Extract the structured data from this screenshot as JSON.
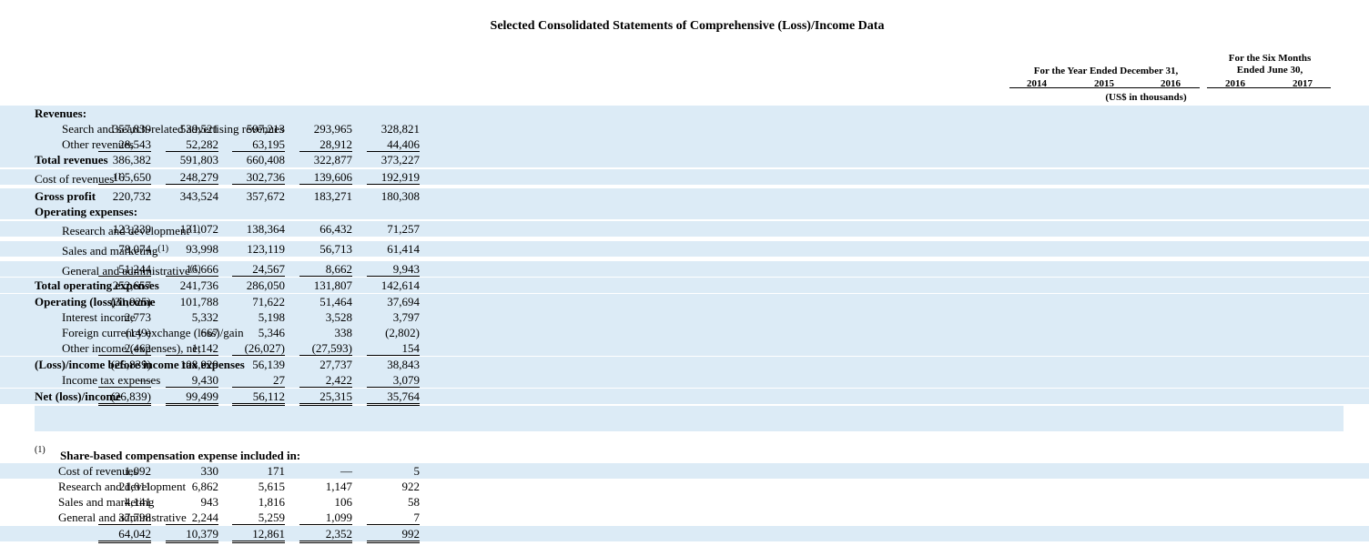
{
  "title": "Selected Consolidated Statements of Comprehensive (Loss)/Income Data",
  "header": {
    "year_group": "For the Year Ended December 31,",
    "six_group_line1": "For the Six Months",
    "six_group_line2": "Ended June 30,",
    "cols": [
      "2014",
      "2015",
      "2016",
      "2016",
      "2017"
    ],
    "units": "(US$ in thousands)"
  },
  "rows": [
    {
      "label": "Revenues:",
      "bold": true,
      "indent": 0,
      "values": []
    },
    {
      "label": "Search and search-related advertising revenues",
      "indent": 1,
      "values": [
        "357,839",
        "539,521",
        "597,213",
        "293,965",
        "328,821"
      ]
    },
    {
      "label": "Other revenues",
      "indent": 1,
      "values": [
        "28,543",
        "52,282",
        "63,195",
        "28,912",
        "44,406"
      ]
    },
    {
      "label": "Total revenues",
      "bold": true,
      "indent": 0,
      "values": [
        "386,382",
        "591,803",
        "660,408",
        "322,877",
        "373,227"
      ]
    },
    {
      "label": "Cost of revenues",
      "sup": "(1)",
      "indent": 0,
      "values": [
        "165,650",
        "248,279",
        "302,736",
        "139,606",
        "192,919"
      ]
    },
    {
      "label": "Gross profit",
      "bold": true,
      "indent": 0,
      "values": [
        "220,732",
        "343,524",
        "357,672",
        "183,271",
        "180,308"
      ]
    },
    {
      "label": "Operating expenses:",
      "bold": true,
      "indent": 0,
      "values": []
    },
    {
      "label": "Research and development",
      "sup": "(1)",
      "indent": 1,
      "values": [
        "123,339",
        "131,072",
        "138,364",
        "66,432",
        "71,257"
      ]
    },
    {
      "label": "Sales and marketing",
      "sup": "(1)",
      "indent": 1,
      "values": [
        "78,074",
        "93,998",
        "123,119",
        "56,713",
        "61,414"
      ]
    },
    {
      "label": "General and administrative",
      "sup": "(1)",
      "indent": 1,
      "values": [
        "51,244",
        "16,666",
        "24,567",
        "8,662",
        "9,943"
      ]
    },
    {
      "label": "Total operating expenses",
      "bold": true,
      "indent": 0,
      "values": [
        "252,657",
        "241,736",
        "286,050",
        "131,807",
        "142,614"
      ]
    },
    {
      "label": "Operating (loss)/income",
      "bold": true,
      "indent": 0,
      "values": [
        "(31,925)",
        "101,788",
        "71,622",
        "51,464",
        "37,694"
      ]
    },
    {
      "label": "Interest income",
      "indent": 1,
      "values": [
        "2,773",
        "5,332",
        "5,198",
        "3,528",
        "3,797"
      ]
    },
    {
      "label": "Foreign currency exchange (loss)/gain",
      "indent": 1,
      "values": [
        "(149)",
        "667",
        "5,346",
        "338",
        "(2,802)"
      ]
    },
    {
      "label": "Other income/(expenses), net",
      "indent": 1,
      "values": [
        "2,462",
        "1,142",
        "(26,027)",
        "(27,593)",
        "154"
      ]
    },
    {
      "label": "(Loss)/income before income tax expenses",
      "bold": true,
      "indent": 0,
      "values": [
        "(26,839)",
        "108,929",
        "56,139",
        "27,737",
        "38,843"
      ]
    },
    {
      "label": "Income tax expenses",
      "indent": 1,
      "values": [
        "—",
        "9,430",
        "27",
        "2,422",
        "3,079"
      ]
    },
    {
      "label": "Net (loss)/income",
      "bold": true,
      "indent": 0,
      "values": [
        "(26,839)",
        "99,499",
        "56,112",
        "25,315",
        "35,764"
      ]
    }
  ],
  "footnote": {
    "marker": "(1)",
    "heading": "Share-based compensation expense included in:",
    "rows": [
      {
        "label": "Cost of revenues",
        "values": [
          "1,092",
          "330",
          "171",
          "—",
          "5"
        ]
      },
      {
        "label": "Research and development",
        "values": [
          "21,011",
          "6,862",
          "5,615",
          "1,147",
          "922"
        ]
      },
      {
        "label": "Sales and marketing",
        "values": [
          "4,141",
          "943",
          "1,816",
          "106",
          "58"
        ]
      },
      {
        "label": "General and administrative",
        "values": [
          "37,798",
          "2,244",
          "5,259",
          "1,099",
          "7"
        ]
      },
      {
        "label": "",
        "values": [
          "64,042",
          "10,379",
          "12,861",
          "2,352",
          "992"
        ]
      }
    ]
  }
}
